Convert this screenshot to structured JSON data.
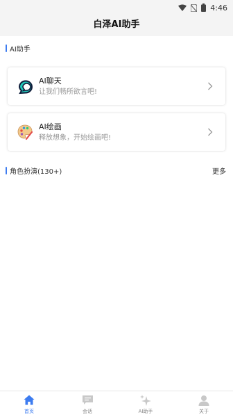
{
  "status_bar": {
    "time": "4:46"
  },
  "title": "白泽AI助手",
  "section_ai": {
    "title": "AI助手"
  },
  "cards": [
    {
      "title": "AI聊天",
      "subtitle": "让我们畅所欲言吧!",
      "icon": "chat-bubble-icon"
    },
    {
      "title": "AI绘画",
      "subtitle": "释放想象，开始绘画吧!",
      "icon": "palette-icon"
    }
  ],
  "section_roles": {
    "title": "角色扮演(130+)",
    "more": "更多"
  },
  "tabs": [
    {
      "label": "首页",
      "icon": "home-icon",
      "active": true
    },
    {
      "label": "会话",
      "icon": "message-icon",
      "active": false
    },
    {
      "label": "AI助手",
      "icon": "sparkle-icon",
      "active": false
    },
    {
      "label": "关于",
      "icon": "person-icon",
      "active": false
    }
  ],
  "colors": {
    "accent": "#3d7cf0",
    "inactive": "#c8c8c8"
  }
}
